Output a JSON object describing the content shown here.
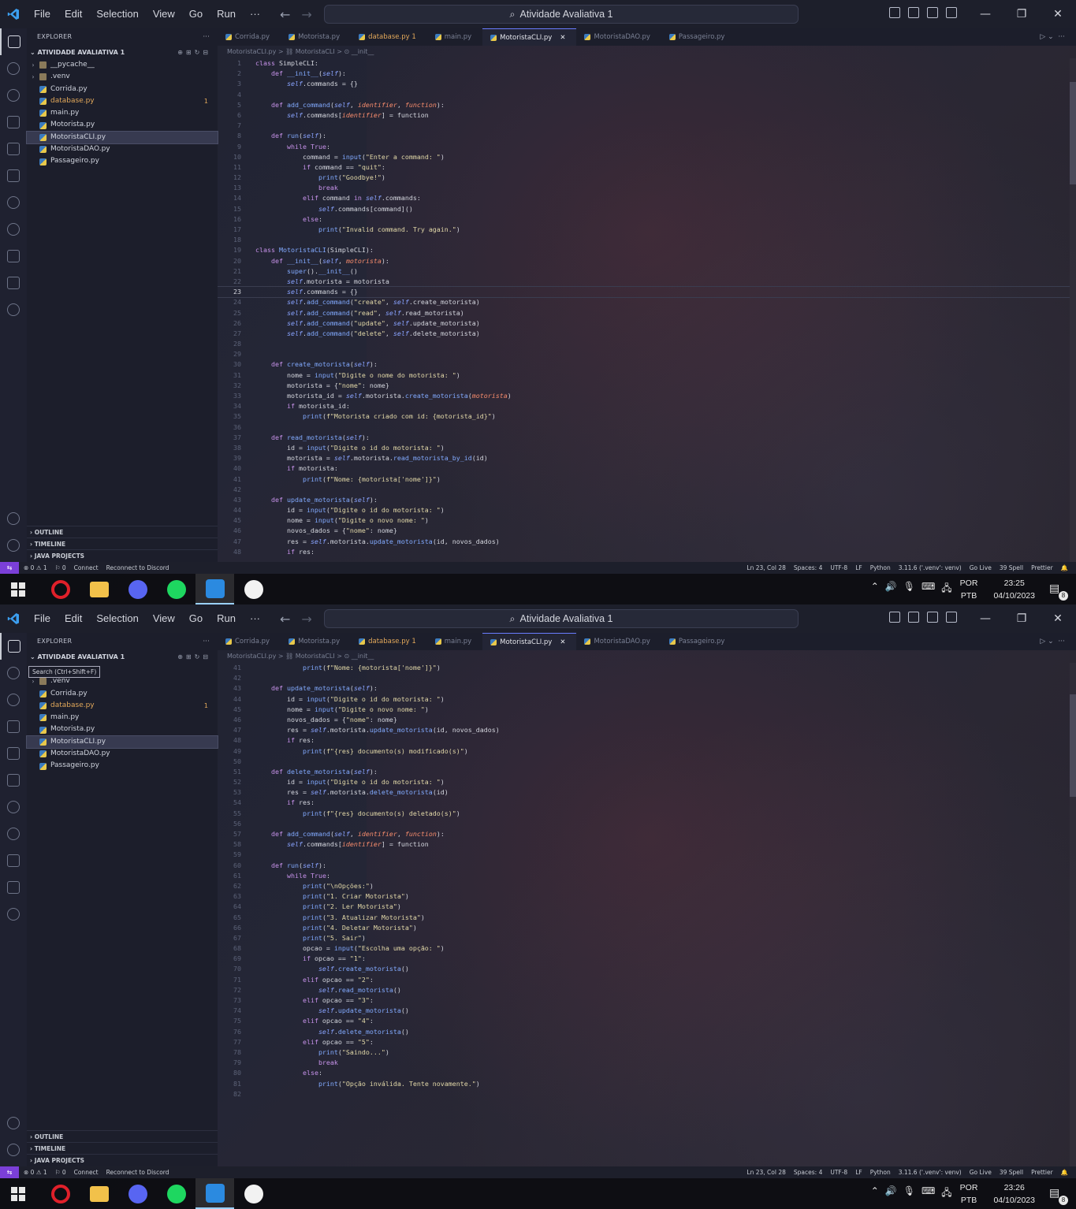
{
  "app": {
    "menu": [
      "File",
      "Edit",
      "Selection",
      "View",
      "Go",
      "Run",
      "···"
    ],
    "title": "Atividade Avaliativa 1"
  },
  "explorer": {
    "header": "EXPLORER",
    "more": "···",
    "folder": "ATIVIDADE AVALIATIVA 1",
    "items_top": [
      "__pycache__",
      ".venv",
      "Corrida.py",
      "database.py",
      "main.py",
      "Motorista.py",
      "MotoristaCLI.py",
      "MotoristaDAO.py",
      "Passageiro.py"
    ],
    "items_bottom": [
      ".venv",
      "Corrida.py",
      "database.py",
      "main.py",
      "Motorista.py",
      "MotoristaCLI.py",
      "MotoristaDAO.py",
      "Passageiro.py"
    ],
    "badge": "1",
    "sections": [
      "OUTLINE",
      "TIMELINE",
      "JAVA PROJECTS"
    ],
    "search_tooltip": "Search (Ctrl+Shift+F)"
  },
  "tabs": [
    "Corrida.py",
    "Motorista.py",
    "database.py 1",
    "main.py",
    "MotoristaCLI.py",
    "MotoristaDAO.py",
    "Passageiro.py"
  ],
  "breadcrumb_top": "MotoristaCLI.py > ⛓ MotoristaCLI > ⊙ __init__",
  "breadcrumb_bottom": "MotoristaCLI.py > ⛓ MotoristaCLI > ⊙ __init__",
  "code_top": {
    "start": 1,
    "lines": [
      "class SimpleCLI:",
      "    def __init__(self):",
      "        self.commands = {}",
      "",
      "    def add_command(self, identifier, function):",
      "        self.commands[identifier] = function",
      "",
      "    def run(self):",
      "        while True:",
      "            command = input(\"Enter a command: \")",
      "            if command == \"quit\":",
      "                print(\"Goodbye!\")",
      "                break",
      "            elif command in self.commands:",
      "                self.commands[command]()",
      "            else:",
      "                print(\"Invalid command. Try again.\")",
      "",
      "class MotoristaCLI(SimpleCLI):",
      "    def __init__(self, motorista):",
      "        super().__init__()",
      "        self.motorista = motorista",
      "        self.commands = {}",
      "        self.add_command(\"create\", self.create_motorista)",
      "        self.add_command(\"read\", self.read_motorista)",
      "        self.add_command(\"update\", self.update_motorista)",
      "        self.add_command(\"delete\", self.delete_motorista)",
      "",
      "",
      "    def create_motorista(self):",
      "        nome = input(\"Digite o nome do motorista: \")",
      "        motorista = {\"nome\": nome}",
      "        motorista_id = self.motorista.create_motorista(motorista)",
      "        if motorista_id:",
      "            print(f\"Motorista criado com id: {motorista_id}\")",
      "",
      "    def read_motorista(self):",
      "        id = input(\"Digite o id do motorista: \")",
      "        motorista = self.motorista.read_motorista_by_id(id)",
      "        if motorista:",
      "            print(f\"Nome: {motorista['nome']}\")",
      "",
      "    def update_motorista(self):",
      "        id = input(\"Digite o id do motorista: \")",
      "        nome = input(\"Digite o novo nome: \")",
      "        novos_dados = {\"nome\": nome}",
      "        res = self.motorista.update_motorista(id, novos_dados)",
      "        if res:"
    ]
  },
  "code_bottom": {
    "start": 41,
    "lines": [
      "            print(f\"Nome: {motorista['nome']}\")",
      "",
      "    def update_motorista(self):",
      "        id = input(\"Digite o id do motorista: \")",
      "        nome = input(\"Digite o novo nome: \")",
      "        novos_dados = {\"nome\": nome}",
      "        res = self.motorista.update_motorista(id, novos_dados)",
      "        if res:",
      "            print(f\"{res} documento(s) modificado(s)\")",
      "",
      "    def delete_motorista(self):",
      "        id = input(\"Digite o id do motorista: \")",
      "        res = self.motorista.delete_motorista(id)",
      "        if res:",
      "            print(f\"{res} documento(s) deletado(s)\")",
      "",
      "    def add_command(self, identifier, function):",
      "        self.commands[identifier] = function",
      "",
      "    def run(self):",
      "        while True:",
      "            print(\"\\nOpções:\")",
      "            print(\"1. Criar Motorista\")",
      "            print(\"2. Ler Motorista\")",
      "            print(\"3. Atualizar Motorista\")",
      "            print(\"4. Deletar Motorista\")",
      "            print(\"5. Sair\")",
      "            opcao = input(\"Escolha uma opção: \")",
      "            if opcao == \"1\":",
      "                self.create_motorista()",
      "            elif opcao == \"2\":",
      "                self.read_motorista()",
      "            elif opcao == \"3\":",
      "                self.update_motorista()",
      "            elif opcao == \"4\":",
      "                self.delete_motorista()",
      "            elif opcao == \"5\":",
      "                print(\"Saindo...\")",
      "                break",
      "            else:",
      "                print(\"Opção inválida. Tente novamente.\")",
      ""
    ]
  },
  "status": {
    "left": [
      "⊗ 0 ⚠ 1",
      "⚐ 0",
      "Connect",
      "Reconnect to Discord"
    ],
    "right": [
      "Ln 23, Col 28",
      "Spaces: 4",
      "UTF-8",
      "LF",
      "Python",
      "3.11.6 ('.venv': venv)",
      "Go Live",
      "39 Spell",
      "Prettier"
    ]
  },
  "taskbar": {
    "lang1": "POR",
    "lang2": "PTB",
    "time_top": "23:25",
    "time_bottom": "23:26",
    "date": "04/10/2023",
    "notif_count": "8",
    "apps": [
      "opera-icon",
      "file-explorer-icon",
      "discord-icon",
      "spotify-icon",
      "vscode-icon",
      "mongodb-compass-icon"
    ]
  },
  "colors": {
    "accent": "#6a7cff",
    "remote": "#7b3fd8",
    "warning": "#e2a85a"
  }
}
